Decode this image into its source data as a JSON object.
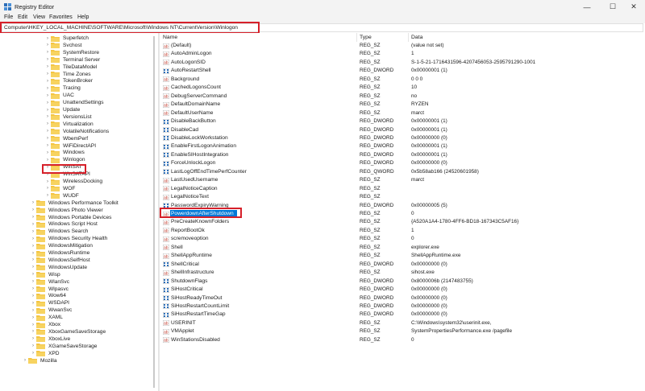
{
  "window": {
    "title": "Registry Editor",
    "minimize_glyph": "—",
    "maximize_glyph": "☐",
    "close_glyph": "✕"
  },
  "menu": [
    "File",
    "Edit",
    "View",
    "Favorites",
    "Help"
  ],
  "address": "Computer\\HKEY_LOCAL_MACHINE\\SOFTWARE\\Microsoft\\Windows NT\\CurrentVersion\\Winlogon",
  "tree": [
    {
      "label": "Superfetch",
      "level": 2
    },
    {
      "label": "Svchost",
      "level": 2
    },
    {
      "label": "SystemRestore",
      "level": 2
    },
    {
      "label": "Terminal Server",
      "level": 2
    },
    {
      "label": "TileDataModel",
      "level": 2
    },
    {
      "label": "Time Zones",
      "level": 2
    },
    {
      "label": "TokenBroker",
      "level": 2
    },
    {
      "label": "Tracing",
      "level": 2
    },
    {
      "label": "UAC",
      "level": 2
    },
    {
      "label": "UnattendSettings",
      "level": 2
    },
    {
      "label": "Update",
      "level": 2
    },
    {
      "label": "VersionsList",
      "level": 2
    },
    {
      "label": "Virtualization",
      "level": 2
    },
    {
      "label": "VolatileNotifications",
      "level": 2
    },
    {
      "label": "WbemPerf",
      "level": 2
    },
    {
      "label": "WiFiDirectAPI",
      "level": 2
    },
    {
      "label": "Windows",
      "level": 2
    },
    {
      "label": "Winlogon",
      "level": 2,
      "selected": true
    },
    {
      "label": "WinSAT",
      "level": 2
    },
    {
      "label": "WinSATAPI",
      "level": 2
    },
    {
      "label": "WirelessDocking",
      "level": 2
    },
    {
      "label": "WOF",
      "level": 2
    },
    {
      "label": "WUDF",
      "level": 2
    },
    {
      "label": "Windows Performance Toolkit",
      "level": 1
    },
    {
      "label": "Windows Photo Viewer",
      "level": 1
    },
    {
      "label": "Windows Portable Devices",
      "level": 1
    },
    {
      "label": "Windows Script Host",
      "level": 1
    },
    {
      "label": "Windows Search",
      "level": 1
    },
    {
      "label": "Windows Security Health",
      "level": 1
    },
    {
      "label": "WindowsMitigation",
      "level": 1
    },
    {
      "label": "WindowsRuntime",
      "level": 1
    },
    {
      "label": "WindowsSelfHost",
      "level": 1
    },
    {
      "label": "WindowsUpdate",
      "level": 1
    },
    {
      "label": "Wisp",
      "level": 1
    },
    {
      "label": "WlanSvc",
      "level": 1
    },
    {
      "label": "Wlpasvc",
      "level": 1
    },
    {
      "label": "Wow64",
      "level": 1
    },
    {
      "label": "WSDAPI",
      "level": 1
    },
    {
      "label": "WwanSvc",
      "level": 1
    },
    {
      "label": "XAML",
      "level": 1
    },
    {
      "label": "Xbox",
      "level": 1
    },
    {
      "label": "XboxGameSaveStorage",
      "level": 1
    },
    {
      "label": "XboxLive",
      "level": 1
    },
    {
      "label": "XGameSaveStorage",
      "level": 1
    },
    {
      "label": "XPD",
      "level": 1
    },
    {
      "label": "Mozilla",
      "level": 0
    }
  ],
  "columns": {
    "name": "Name",
    "type": "Type",
    "data": "Data"
  },
  "values": [
    {
      "name": "(Default)",
      "type": "REG_SZ",
      "data": "(value not set)",
      "kind": "sz"
    },
    {
      "name": "AutoAdminLogon",
      "type": "REG_SZ",
      "data": "1",
      "kind": "sz"
    },
    {
      "name": "AutoLogonSID",
      "type": "REG_SZ",
      "data": "S-1-5-21-1716431596-4207456053-2595791290-1001",
      "kind": "sz"
    },
    {
      "name": "AutoRestartShell",
      "type": "REG_DWORD",
      "data": "0x00000001 (1)",
      "kind": "bin"
    },
    {
      "name": "Background",
      "type": "REG_SZ",
      "data": "0 0 0",
      "kind": "sz"
    },
    {
      "name": "CachedLogonsCount",
      "type": "REG_SZ",
      "data": "10",
      "kind": "sz"
    },
    {
      "name": "DebugServerCommand",
      "type": "REG_SZ",
      "data": "no",
      "kind": "sz"
    },
    {
      "name": "DefaultDomainName",
      "type": "REG_SZ",
      "data": "RYZEN",
      "kind": "sz"
    },
    {
      "name": "DefaultUserName",
      "type": "REG_SZ",
      "data": "marct",
      "kind": "sz"
    },
    {
      "name": "DisableBackButton",
      "type": "REG_DWORD",
      "data": "0x00000001 (1)",
      "kind": "bin"
    },
    {
      "name": "DisableCad",
      "type": "REG_DWORD",
      "data": "0x00000001 (1)",
      "kind": "bin"
    },
    {
      "name": "DisableLockWorkstation",
      "type": "REG_DWORD",
      "data": "0x00000000 (0)",
      "kind": "bin"
    },
    {
      "name": "EnableFirstLogonAnimation",
      "type": "REG_DWORD",
      "data": "0x00000001 (1)",
      "kind": "bin"
    },
    {
      "name": "EnableSIHostIntegration",
      "type": "REG_DWORD",
      "data": "0x00000001 (1)",
      "kind": "bin"
    },
    {
      "name": "ForceUnlockLogon",
      "type": "REG_DWORD",
      "data": "0x00000000 (0)",
      "kind": "bin"
    },
    {
      "name": "LastLogOffEndTimePerfCounter",
      "type": "REG_QWORD",
      "data": "0x5b58ab166 (24520601958)",
      "kind": "bin"
    },
    {
      "name": "LastUsedUsername",
      "type": "REG_SZ",
      "data": "marct",
      "kind": "sz"
    },
    {
      "name": "LegalNoticeCaption",
      "type": "REG_SZ",
      "data": "",
      "kind": "sz"
    },
    {
      "name": "LegalNoticeText",
      "type": "REG_SZ",
      "data": "",
      "kind": "sz"
    },
    {
      "name": "PasswordExpiryWarning",
      "type": "REG_DWORD",
      "data": "0x00000005 (5)",
      "kind": "bin"
    },
    {
      "name": "PowerdownAfterShutdown",
      "type": "REG_SZ",
      "data": "0",
      "kind": "sz",
      "selected": true
    },
    {
      "name": "PreCreateKnownFolders",
      "type": "REG_SZ",
      "data": "{A520A1A4-1780-4FF6-BD18-167343C5AF16}",
      "kind": "sz"
    },
    {
      "name": "ReportBootOk",
      "type": "REG_SZ",
      "data": "1",
      "kind": "sz"
    },
    {
      "name": "scremoveoption",
      "type": "REG_SZ",
      "data": "0",
      "kind": "sz"
    },
    {
      "name": "Shell",
      "type": "REG_SZ",
      "data": "explorer.exe",
      "kind": "sz"
    },
    {
      "name": "ShellAppRuntime",
      "type": "REG_SZ",
      "data": "ShellAppRuntime.exe",
      "kind": "sz"
    },
    {
      "name": "ShellCritical",
      "type": "REG_DWORD",
      "data": "0x00000000 (0)",
      "kind": "bin"
    },
    {
      "name": "ShellInfrastructure",
      "type": "REG_SZ",
      "data": "sihost.exe",
      "kind": "sz"
    },
    {
      "name": "ShutdownFlags",
      "type": "REG_DWORD",
      "data": "0x8000006b (2147483755)",
      "kind": "bin"
    },
    {
      "name": "SiHostCritical",
      "type": "REG_DWORD",
      "data": "0x00000000 (0)",
      "kind": "bin"
    },
    {
      "name": "SiHostReadyTimeOut",
      "type": "REG_DWORD",
      "data": "0x00000000 (0)",
      "kind": "bin"
    },
    {
      "name": "SiHostRestartCountLimit",
      "type": "REG_DWORD",
      "data": "0x00000000 (0)",
      "kind": "bin"
    },
    {
      "name": "SiHostRestartTimeGap",
      "type": "REG_DWORD",
      "data": "0x00000000 (0)",
      "kind": "bin"
    },
    {
      "name": "USERINIT",
      "type": "REG_SZ",
      "data": "C:\\Windows\\system32\\userinit.exe,",
      "kind": "sz"
    },
    {
      "name": "VMApplet",
      "type": "REG_SZ",
      "data": "SystemPropertiesPerformance.exe /pagefile",
      "kind": "sz"
    },
    {
      "name": "WinStationsDisabled",
      "type": "REG_SZ",
      "data": "0",
      "kind": "sz"
    }
  ],
  "colors": {
    "highlight_box": "#d6202a",
    "selection": "#0078d7",
    "folder": "#f4c542",
    "sz_icon": "#c0392b",
    "bin_icon": "#2d6fb8"
  }
}
